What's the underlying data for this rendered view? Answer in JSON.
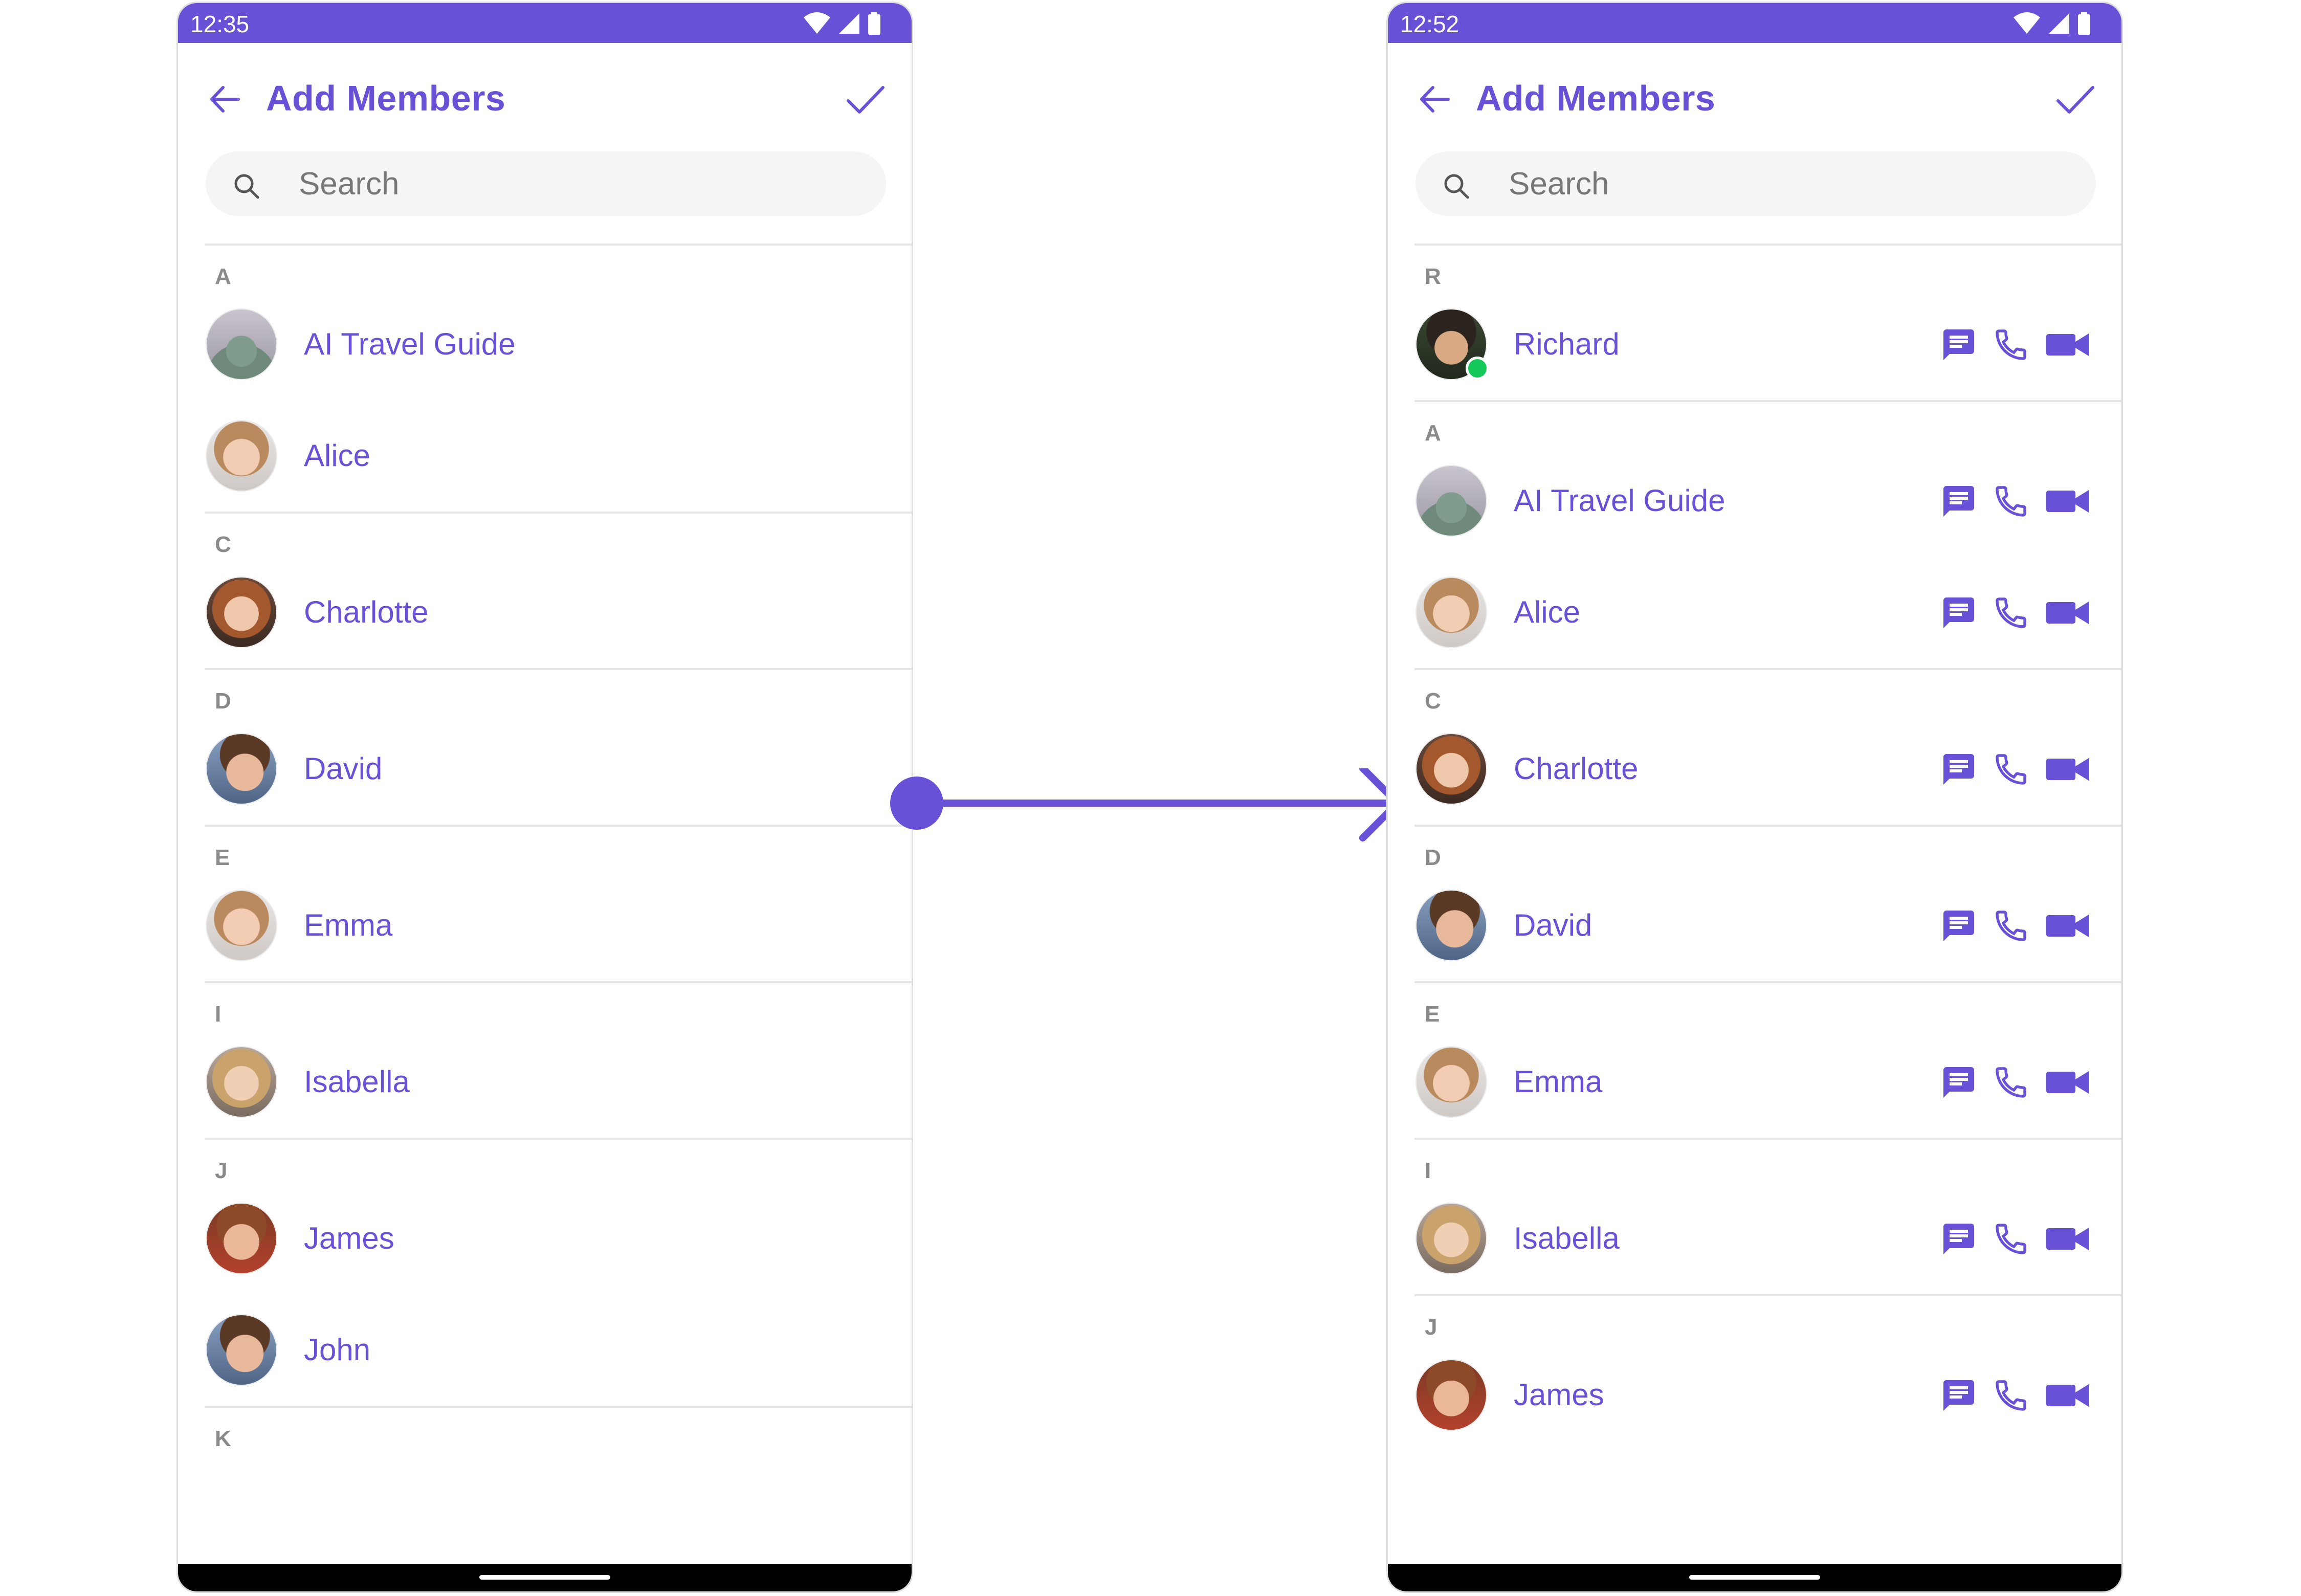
{
  "colors": {
    "accent": "#6851D6",
    "divider": "#E6E6E6",
    "search_bg": "#F5F5F5",
    "online": "#15C85A"
  },
  "left_screen": {
    "status": {
      "time": "12:35"
    },
    "title": "Add Members",
    "search": {
      "placeholder": "Search"
    },
    "sections": [
      {
        "letter": "A",
        "members": [
          {
            "name": "AI Travel Guide",
            "avatar": "statue"
          },
          {
            "name": "Alice",
            "avatar": "woman-light"
          }
        ]
      },
      {
        "letter": "C",
        "members": [
          {
            "name": "Charlotte",
            "avatar": "woman-auburn"
          }
        ]
      },
      {
        "letter": "D",
        "members": [
          {
            "name": "David",
            "avatar": "man-brown"
          }
        ]
      },
      {
        "letter": "E",
        "members": [
          {
            "name": "Emma",
            "avatar": "woman-light"
          }
        ]
      },
      {
        "letter": "I",
        "members": [
          {
            "name": "Isabella",
            "avatar": "woman-blonde"
          }
        ]
      },
      {
        "letter": "J",
        "members": [
          {
            "name": "James",
            "avatar": "man-auburn"
          },
          {
            "name": "John",
            "avatar": "man-brown"
          }
        ]
      },
      {
        "letter": "K",
        "members": []
      }
    ]
  },
  "right_screen": {
    "status": {
      "time": "12:52"
    },
    "title": "Add Members",
    "search": {
      "placeholder": "Search"
    },
    "actions": [
      "message-icon",
      "voice-call-icon",
      "video-call-icon"
    ],
    "sections": [
      {
        "letter": "R",
        "members": [
          {
            "name": "Richard",
            "avatar": "man-dark",
            "online": true
          }
        ]
      },
      {
        "letter": "A",
        "members": [
          {
            "name": "AI Travel Guide",
            "avatar": "statue"
          },
          {
            "name": "Alice",
            "avatar": "woman-light"
          }
        ]
      },
      {
        "letter": "C",
        "members": [
          {
            "name": "Charlotte",
            "avatar": "woman-auburn"
          }
        ]
      },
      {
        "letter": "D",
        "members": [
          {
            "name": "David",
            "avatar": "man-brown"
          }
        ]
      },
      {
        "letter": "E",
        "members": [
          {
            "name": "Emma",
            "avatar": "woman-light"
          }
        ]
      },
      {
        "letter": "I",
        "members": [
          {
            "name": "Isabella",
            "avatar": "woman-blonde"
          }
        ]
      },
      {
        "letter": "J",
        "members": [
          {
            "name": "James",
            "avatar": "man-auburn"
          }
        ]
      }
    ]
  }
}
